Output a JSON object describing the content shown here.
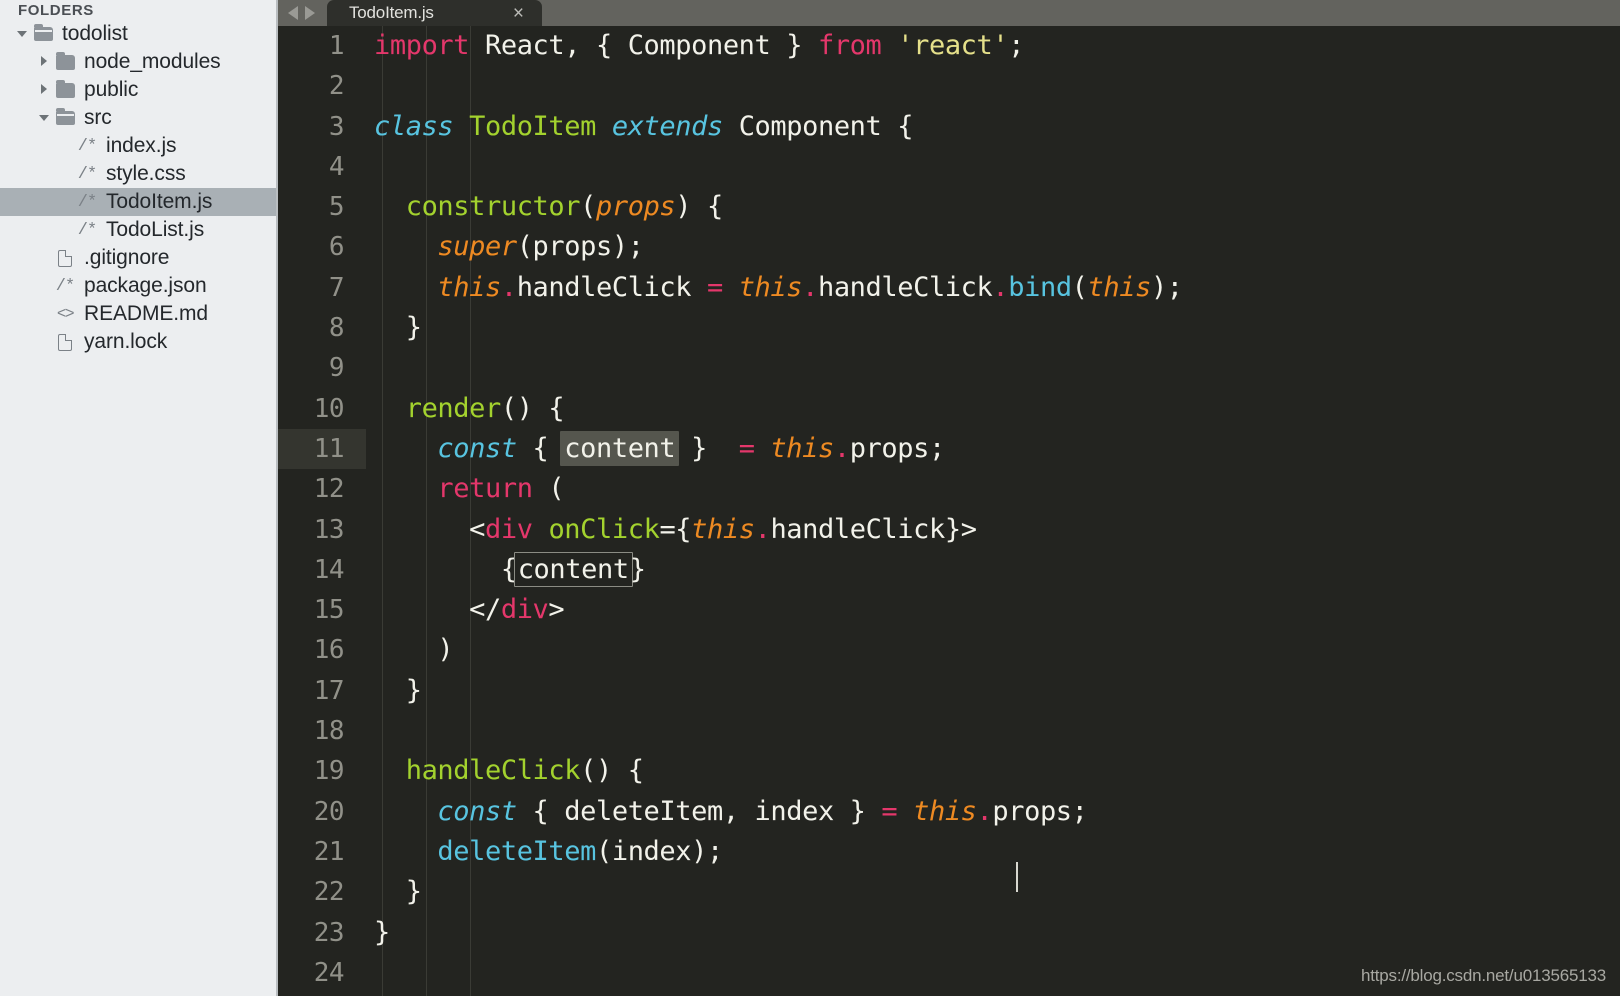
{
  "sidebar": {
    "header": "FOLDERS",
    "items": [
      {
        "label": "todolist",
        "icon": "folder-open-icon",
        "arrow": "down",
        "depth": 0,
        "selected": false
      },
      {
        "label": "node_modules",
        "icon": "folder-closed-icon",
        "arrow": "right",
        "depth": 1,
        "selected": false
      },
      {
        "label": "public",
        "icon": "folder-closed-icon",
        "arrow": "right",
        "depth": 1,
        "selected": false
      },
      {
        "label": "src",
        "icon": "folder-open-icon",
        "arrow": "down",
        "depth": 1,
        "selected": false
      },
      {
        "label": "index.js",
        "icon": "js-file-icon",
        "arrow": "none",
        "depth": 2,
        "selected": false
      },
      {
        "label": "style.css",
        "icon": "js-file-icon",
        "arrow": "none",
        "depth": 2,
        "selected": false
      },
      {
        "label": "TodoItem.js",
        "icon": "js-file-icon",
        "arrow": "none",
        "depth": 2,
        "selected": true
      },
      {
        "label": "TodoList.js",
        "icon": "js-file-icon",
        "arrow": "none",
        "depth": 2,
        "selected": false
      },
      {
        "label": ".gitignore",
        "icon": "document-icon",
        "arrow": "none",
        "depth": 1,
        "selected": false
      },
      {
        "label": "package.json",
        "icon": "js-file-icon",
        "arrow": "none",
        "depth": 1,
        "selected": false
      },
      {
        "label": "README.md",
        "icon": "markup-icon",
        "arrow": "none",
        "depth": 1,
        "selected": false
      },
      {
        "label": "yarn.lock",
        "icon": "document-icon",
        "arrow": "none",
        "depth": 1,
        "selected": false
      }
    ]
  },
  "tabbar": {
    "nav_back": "◀",
    "nav_forward": "▶",
    "tabs": [
      {
        "title": "TodoItem.js",
        "close": "×",
        "active": true
      }
    ]
  },
  "editor": {
    "file": "TodoItem.js",
    "active_line": 11,
    "watermark": "https://blog.csdn.net/u013565133",
    "lines": [
      {
        "n": "1",
        "tokens": [
          {
            "t": "import",
            "c": "k-kw"
          },
          {
            "t": " React, { Component } ",
            "c": "k-plain"
          },
          {
            "t": "from",
            "c": "k-kw"
          },
          {
            "t": " ",
            "c": "k-plain"
          },
          {
            "t": "'react'",
            "c": "k-str"
          },
          {
            "t": ";",
            "c": "k-plain"
          }
        ]
      },
      {
        "n": "2",
        "tokens": []
      },
      {
        "n": "3",
        "tokens": [
          {
            "t": "class",
            "c": "k-ctrl"
          },
          {
            "t": " ",
            "c": "k-plain"
          },
          {
            "t": "TodoItem",
            "c": "k-cls"
          },
          {
            "t": " ",
            "c": "k-plain"
          },
          {
            "t": "extends",
            "c": "k-ctrl"
          },
          {
            "t": " Component {",
            "c": "k-plain"
          }
        ]
      },
      {
        "n": "4",
        "tokens": []
      },
      {
        "n": "5",
        "tokens": [
          {
            "t": "  ",
            "c": "k-plain"
          },
          {
            "t": "constructor",
            "c": "k-fn"
          },
          {
            "t": "(",
            "c": "k-plain"
          },
          {
            "t": "props",
            "c": "k-this"
          },
          {
            "t": ") {",
            "c": "k-plain"
          }
        ]
      },
      {
        "n": "6",
        "tokens": [
          {
            "t": "    ",
            "c": "k-plain"
          },
          {
            "t": "super",
            "c": "k-this"
          },
          {
            "t": "(props);",
            "c": "k-plain"
          }
        ]
      },
      {
        "n": "7",
        "tokens": [
          {
            "t": "    ",
            "c": "k-plain"
          },
          {
            "t": "this",
            "c": "k-this"
          },
          {
            "t": ".",
            "c": "k-dot"
          },
          {
            "t": "handleClick ",
            "c": "k-plain"
          },
          {
            "t": "=",
            "c": "k-op"
          },
          {
            "t": " ",
            "c": "k-plain"
          },
          {
            "t": "this",
            "c": "k-this"
          },
          {
            "t": ".",
            "c": "k-dot"
          },
          {
            "t": "handleClick",
            "c": "k-plain"
          },
          {
            "t": ".",
            "c": "k-dot"
          },
          {
            "t": "bind",
            "c": "k-mth"
          },
          {
            "t": "(",
            "c": "k-plain"
          },
          {
            "t": "this",
            "c": "k-this"
          },
          {
            "t": ");",
            "c": "k-plain"
          }
        ]
      },
      {
        "n": "8",
        "tokens": [
          {
            "t": "  }",
            "c": "k-plain"
          }
        ]
      },
      {
        "n": "9",
        "tokens": []
      },
      {
        "n": "10",
        "tokens": [
          {
            "t": "  ",
            "c": "k-plain"
          },
          {
            "t": "render",
            "c": "k-fn"
          },
          {
            "t": "() {",
            "c": "k-plain"
          }
        ]
      },
      {
        "n": "11",
        "tokens": [
          {
            "t": "    ",
            "c": "k-plain"
          },
          {
            "t": "const",
            "c": "k-ctrl"
          },
          {
            "t": " { ",
            "c": "k-plain"
          },
          {
            "t": "content",
            "c": "k-plain",
            "box": "sel"
          },
          {
            "t": " }  ",
            "c": "k-plain"
          },
          {
            "t": "=",
            "c": "k-op"
          },
          {
            "t": " ",
            "c": "k-plain"
          },
          {
            "t": "this",
            "c": "k-this"
          },
          {
            "t": ".",
            "c": "k-dot"
          },
          {
            "t": "props;",
            "c": "k-plain"
          }
        ]
      },
      {
        "n": "12",
        "tokens": [
          {
            "t": "    ",
            "c": "k-plain"
          },
          {
            "t": "return",
            "c": "k-kw"
          },
          {
            "t": " (",
            "c": "k-plain"
          }
        ]
      },
      {
        "n": "13",
        "tokens": [
          {
            "t": "      <",
            "c": "k-plain"
          },
          {
            "t": "div",
            "c": "k-tag"
          },
          {
            "t": " ",
            "c": "k-plain"
          },
          {
            "t": "onClick",
            "c": "k-fn"
          },
          {
            "t": "={",
            "c": "k-plain"
          },
          {
            "t": "this",
            "c": "k-this"
          },
          {
            "t": ".",
            "c": "k-dot"
          },
          {
            "t": "handleClick}>",
            "c": "k-plain"
          }
        ]
      },
      {
        "n": "14",
        "tokens": [
          {
            "t": "        {",
            "c": "k-plain"
          },
          {
            "t": "content",
            "c": "k-plain",
            "box": "match"
          },
          {
            "t": "}",
            "c": "k-plain"
          }
        ]
      },
      {
        "n": "15",
        "tokens": [
          {
            "t": "      </",
            "c": "k-plain"
          },
          {
            "t": "div",
            "c": "k-tag"
          },
          {
            "t": ">",
            "c": "k-plain"
          }
        ]
      },
      {
        "n": "16",
        "tokens": [
          {
            "t": "    )",
            "c": "k-plain"
          }
        ]
      },
      {
        "n": "17",
        "tokens": [
          {
            "t": "  }",
            "c": "k-plain"
          }
        ]
      },
      {
        "n": "18",
        "tokens": []
      },
      {
        "n": "19",
        "tokens": [
          {
            "t": "  ",
            "c": "k-plain"
          },
          {
            "t": "handleClick",
            "c": "k-fn"
          },
          {
            "t": "() {",
            "c": "k-plain"
          }
        ]
      },
      {
        "n": "20",
        "tokens": [
          {
            "t": "    ",
            "c": "k-plain"
          },
          {
            "t": "const",
            "c": "k-ctrl"
          },
          {
            "t": " { deleteItem, index } ",
            "c": "k-plain"
          },
          {
            "t": "=",
            "c": "k-op"
          },
          {
            "t": " ",
            "c": "k-plain"
          },
          {
            "t": "this",
            "c": "k-this"
          },
          {
            "t": ".",
            "c": "k-dot"
          },
          {
            "t": "props;",
            "c": "k-plain"
          }
        ]
      },
      {
        "n": "21",
        "tokens": [
          {
            "t": "    ",
            "c": "k-plain"
          },
          {
            "t": "deleteItem",
            "c": "k-mth"
          },
          {
            "t": "(index);",
            "c": "k-plain"
          }
        ]
      },
      {
        "n": "22",
        "tokens": [
          {
            "t": "  }",
            "c": "k-plain"
          }
        ]
      },
      {
        "n": "23",
        "tokens": [
          {
            "t": "}",
            "c": "k-plain"
          }
        ]
      },
      {
        "n": "24",
        "tokens": []
      }
    ]
  }
}
